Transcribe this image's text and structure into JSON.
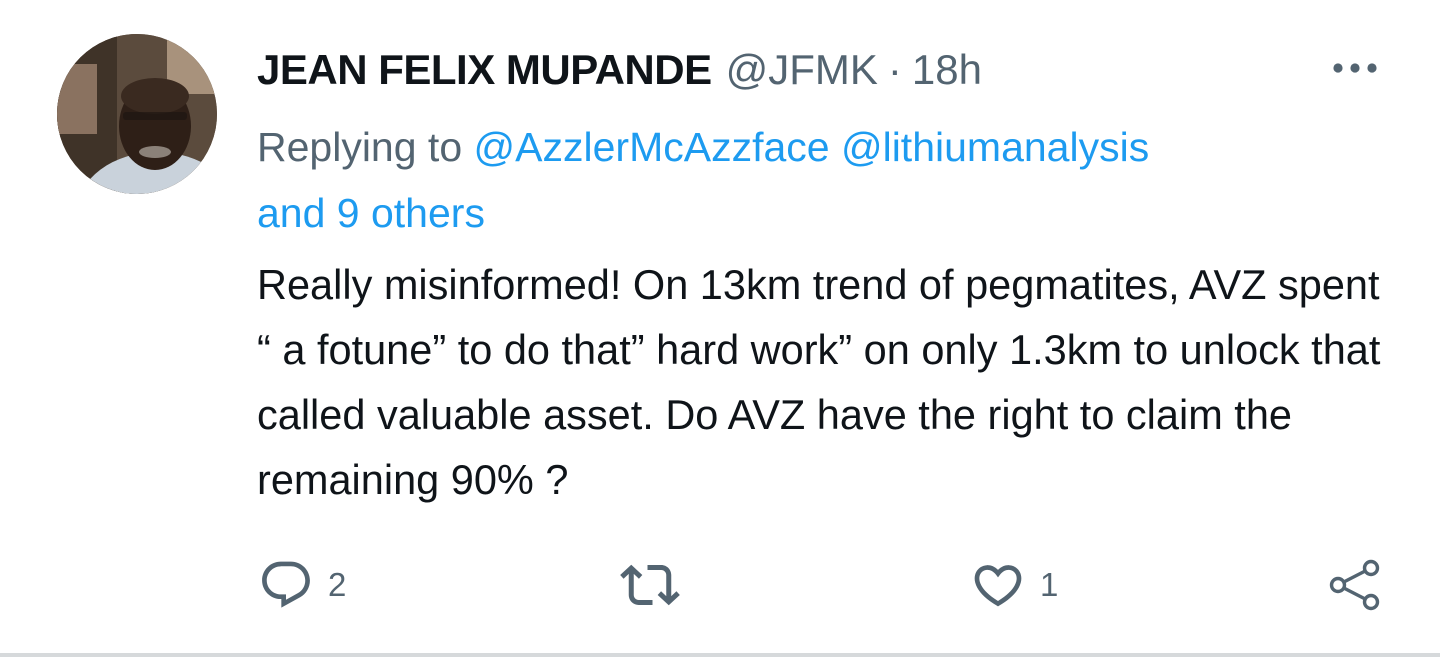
{
  "author": {
    "name": "JEAN FELIX MUPANDE",
    "handle": "@JFMK",
    "separator": "·",
    "time": "18h"
  },
  "reply": {
    "prefix": "Replying to",
    "mentions": [
      "@AzzlerMcAzzface",
      "@lithiumanalysis"
    ],
    "and_others": "and 9 others"
  },
  "tweet": {
    "text": "Really misinformed! On 13km trend of pegmatites, AVZ spent “ a fotune” to do that” hard work” on only 1.3km to unlock that called valuable asset. Do AVZ have the right to claim the remaining 90% ?"
  },
  "actions": {
    "reply_count": "2",
    "retweet_count": "",
    "like_count": "1"
  },
  "icons": {
    "more": "more-horizontal-icon",
    "reply": "reply-bubble-icon",
    "retweet": "retweet-icon",
    "like": "heart-icon",
    "share": "share-icon"
  },
  "colors": {
    "link": "#1d9bf0",
    "secondary_text": "#536471",
    "primary_text": "#0f1419"
  }
}
